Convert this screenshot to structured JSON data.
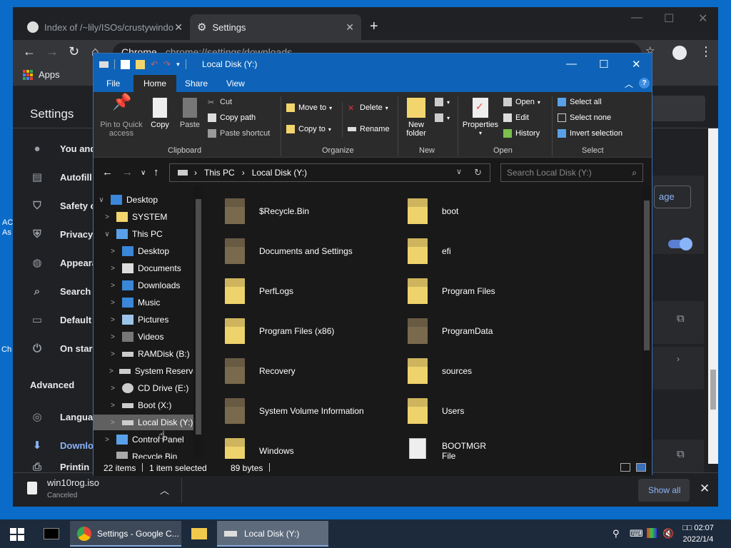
{
  "desktop": {
    "left_text_1": "AC",
    "left_text_2": "As",
    "left_text_3": "Ch"
  },
  "chrome": {
    "tabs": [
      {
        "label": "Index of /~lily/ISOs/crustywindo",
        "close": "✕"
      },
      {
        "label": "Settings",
        "close": "✕"
      }
    ],
    "new_tab": "+",
    "window_controls": {
      "minimize": "—",
      "maximize": "☐",
      "close": "✕"
    },
    "omnibox": {
      "site": "Chrome",
      "url": "chrome://settings/downloads"
    },
    "bookmarks": {
      "apps_label": "Apps"
    },
    "settings_title": "Settings",
    "sidebar": [
      {
        "label": "You and",
        "icon": "person-icon"
      },
      {
        "label": "Autofill",
        "icon": "clipboard-icon"
      },
      {
        "label": "Safety c",
        "icon": "shield-check-icon"
      },
      {
        "label": "Privacy",
        "icon": "shield-icon"
      },
      {
        "label": "Appeara",
        "icon": "palette-icon"
      },
      {
        "label": "Search",
        "icon": "search-icon"
      },
      {
        "label": "Default",
        "icon": "browser-icon"
      },
      {
        "label": "On star",
        "icon": "power-icon"
      }
    ],
    "advanced_label": "Advanced",
    "advanced_items": [
      {
        "label": "Langua",
        "icon": "globe-icon"
      },
      {
        "label": "Downlo",
        "icon": "download-icon"
      },
      {
        "label": "Printin",
        "icon": "print-icon"
      }
    ],
    "manage_btn": "age",
    "download_bar": {
      "file": "win10rog.iso",
      "status": "Canceled",
      "show_all": "Show all",
      "close": "✕"
    }
  },
  "explorer": {
    "title": "Local Disk (Y:)",
    "ribbon_tabs": [
      "File",
      "Home",
      "Share",
      "View"
    ],
    "clipboard": {
      "pin": "Pin to Quick access",
      "copy": "Copy",
      "paste": "Paste",
      "cut": "Cut",
      "copy_path": "Copy path",
      "paste_shortcut": "Paste shortcut",
      "label": "Clipboard"
    },
    "organize": {
      "move_to": "Move to",
      "copy_to": "Copy to",
      "delete": "Delete",
      "rename": "Rename",
      "label": "Organize"
    },
    "new": {
      "new_folder": "New folder",
      "label": "New"
    },
    "open": {
      "properties": "Properties",
      "open": "Open",
      "edit": "Edit",
      "history": "History",
      "label": "Open"
    },
    "select": {
      "select_all": "Select all",
      "select_none": "Select none",
      "invert": "Invert selection",
      "label": "Select"
    },
    "address": {
      "crumb1": "This PC",
      "crumb2": "Local Disk (Y:)"
    },
    "search_placeholder": "Search Local Disk (Y:)",
    "nav": [
      {
        "label": "Desktop",
        "indent": 0,
        "chev": "∨",
        "icon": "desktop-icon"
      },
      {
        "label": "SYSTEM",
        "indent": 1,
        "chev": ">",
        "icon": "user-folder-icon"
      },
      {
        "label": "This PC",
        "indent": 1,
        "chev": "∨",
        "icon": "computer-icon"
      },
      {
        "label": "Desktop",
        "indent": 2,
        "chev": ">",
        "icon": "desktop-icon"
      },
      {
        "label": "Documents",
        "indent": 2,
        "chev": ">",
        "icon": "documents-icon"
      },
      {
        "label": "Downloads",
        "indent": 2,
        "chev": ">",
        "icon": "downloads-icon"
      },
      {
        "label": "Music",
        "indent": 2,
        "chev": ">",
        "icon": "music-icon"
      },
      {
        "label": "Pictures",
        "indent": 2,
        "chev": ">",
        "icon": "pictures-icon"
      },
      {
        "label": "Videos",
        "indent": 2,
        "chev": ">",
        "icon": "videos-icon"
      },
      {
        "label": "RAMDisk (B:)",
        "indent": 2,
        "chev": ">",
        "icon": "drive-icon"
      },
      {
        "label": "System Reserve",
        "indent": 2,
        "chev": ">",
        "icon": "drive-icon"
      },
      {
        "label": "CD Drive (E:)",
        "indent": 2,
        "chev": ">",
        "icon": "cd-drive-icon"
      },
      {
        "label": "Boot (X:)",
        "indent": 2,
        "chev": ">",
        "icon": "drive-icon"
      },
      {
        "label": "Local Disk (Y:)",
        "indent": 2,
        "chev": ">",
        "icon": "drive-icon",
        "selected": true
      },
      {
        "label": "Control Panel",
        "indent": 1,
        "chev": ">",
        "icon": "control-panel-icon"
      },
      {
        "label": "Recycle Bin",
        "indent": 1,
        "chev": "",
        "icon": "recycle-bin-icon"
      }
    ],
    "files": [
      {
        "name": "$Recycle.Bin",
        "kind": "folder-dark"
      },
      {
        "name": "boot",
        "kind": "folder-light"
      },
      {
        "name": "Documents and Settings",
        "kind": "folder-dark"
      },
      {
        "name": "efi",
        "kind": "folder-light"
      },
      {
        "name": "PerfLogs",
        "kind": "folder-light"
      },
      {
        "name": "Program Files",
        "kind": "folder-light"
      },
      {
        "name": "Program Files (x86)",
        "kind": "folder-light"
      },
      {
        "name": "ProgramData",
        "kind": "folder-dark"
      },
      {
        "name": "Recovery",
        "kind": "folder-dark"
      },
      {
        "name": "sources",
        "kind": "folder-light"
      },
      {
        "name": "System Volume Information",
        "kind": "folder-dark"
      },
      {
        "name": "Users",
        "kind": "folder-light"
      },
      {
        "name": "Windows",
        "kind": "folder-light"
      },
      {
        "name": "BOOTMGR\nFile",
        "kind": "file"
      }
    ],
    "status": {
      "items": "22 items",
      "selected": "1 item selected",
      "size": "89 bytes"
    }
  },
  "taskbar": {
    "buttons": [
      {
        "label": "",
        "icon": "terminal-icon"
      },
      {
        "label": "Settings - Google C...",
        "icon": "chrome-icon"
      },
      {
        "label": "",
        "icon": "file-explorer-icon"
      },
      {
        "label": "Local Disk (Y:)",
        "icon": "drive-icon"
      }
    ],
    "clock_time": "□□ 02:07",
    "clock_date": "2022/1/4"
  }
}
